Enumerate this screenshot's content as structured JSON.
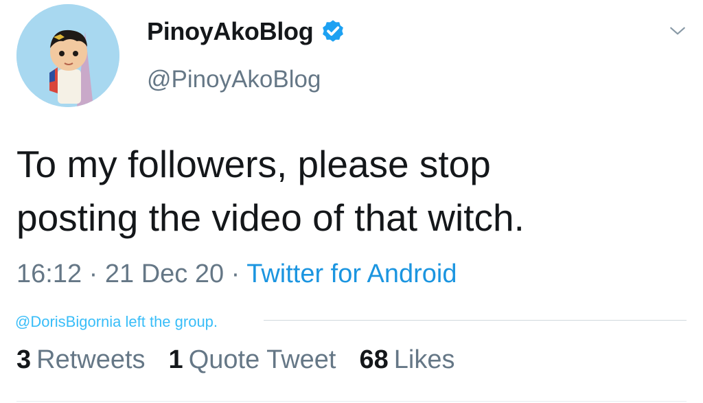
{
  "author": {
    "display_name": "PinoyAkoBlog",
    "handle": "@PinoyAkoBlog",
    "verified": true
  },
  "tweet": {
    "text": "To my followers, please stop\nposting the video of that witch.",
    "time": "16:12",
    "date": "21 Dec 20",
    "separator": "·",
    "source": "Twitter for Android"
  },
  "overlay_note": "@DorisBigornia left the group.",
  "stats": {
    "retweets_count": "3",
    "retweets_label": "Retweets",
    "quotes_count": "1",
    "quotes_label": "Quote Tweet",
    "likes_count": "68",
    "likes_label": "Likes"
  },
  "colors": {
    "text": "#14171a",
    "muted": "#657786",
    "link": "#1b95e0",
    "overlay": "#38bdf8",
    "verified": "#1da1f2"
  },
  "icons": {
    "verified": "verified-badge-icon",
    "menu": "chevron-down-icon"
  }
}
